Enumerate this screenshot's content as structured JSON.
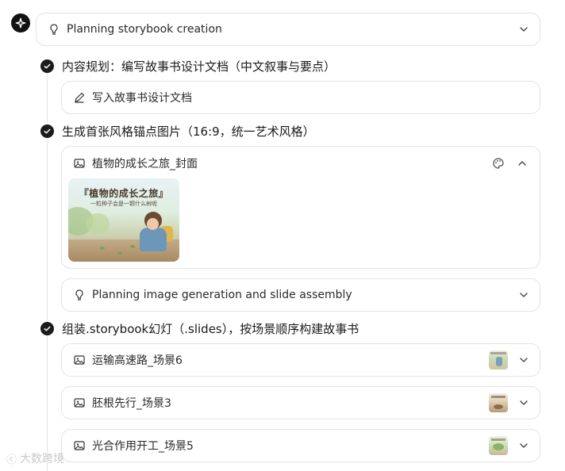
{
  "header": {
    "planning_label": "Planning storybook creation"
  },
  "steps": [
    {
      "label": "内容规划：编写故事书设计文档（中文叙事与要点）",
      "action_label": "写入故事书设计文档"
    },
    {
      "label": "生成首张风格锚点图片（16:9，统一艺术风格）",
      "image_card_title": "植物的成长之旅_封面",
      "image_title_text": "『植物的成长之旅』",
      "image_subtitle_text": "一粒种子会是一颗什么树呢",
      "planning2_label": "Planning image generation and slide assembly"
    },
    {
      "label": "组装.storybook幻灯（.slides），按场景顺序构建故事书",
      "images": [
        {
          "title": "运输高速路_场景6"
        },
        {
          "title": "胚根先行_场景3"
        },
        {
          "title": "光合作用开工_场景5"
        }
      ]
    }
  ],
  "watermark": "大数跨境",
  "icons": {
    "logo": "app-logo-icon",
    "bulb": "lightbulb-icon",
    "pencil": "pencil-icon",
    "image": "image-icon",
    "palette": "palette-icon",
    "chevron": "chevron-down-icon",
    "chevron_up": "chevron-up-icon",
    "check": "check-icon"
  },
  "colors": {
    "check_bg": "#1c1c1c",
    "border": "#e3e3e3",
    "text": "#1f1f1f"
  }
}
